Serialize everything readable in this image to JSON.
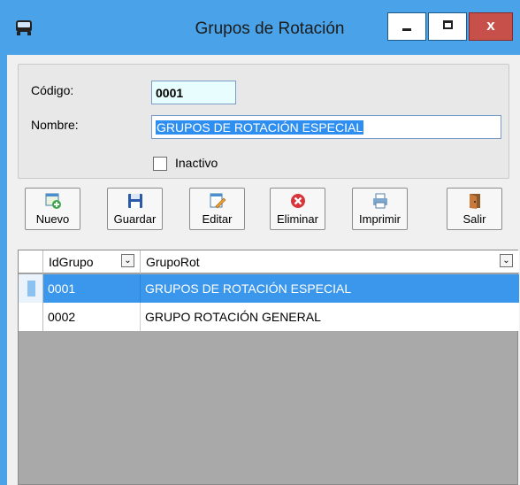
{
  "window": {
    "title": "Grupos de Rotación",
    "min_glyph": "",
    "max_glyph": "",
    "close_glyph": "x"
  },
  "form": {
    "codigo_label": "Código:",
    "codigo_value": "0001",
    "nombre_label": "Nombre:",
    "nombre_value": "GRUPOS DE ROTACIÓN ESPECIAL",
    "inactivo_label": "Inactivo",
    "inactivo_checked": false
  },
  "toolbar": [
    {
      "label": "Nuevo",
      "icon": "new-record-icon"
    },
    {
      "label": "Guardar",
      "icon": "save-icon"
    },
    {
      "label": "Editar",
      "icon": "edit-icon"
    },
    {
      "label": "Eliminar",
      "icon": "delete-icon"
    },
    {
      "label": "Imprimir",
      "icon": "print-icon"
    },
    {
      "label": "Salir",
      "icon": "exit-door-icon"
    }
  ],
  "grid": {
    "columns": [
      "IdGrupo",
      "GrupoRot"
    ],
    "rows": [
      {
        "id": "0001",
        "name": "GRUPOS DE ROTACIÓN ESPECIAL",
        "selected": true
      },
      {
        "id": "0002",
        "name": "GRUPO ROTACIÓN GENERAL",
        "selected": false
      }
    ]
  },
  "colors": {
    "titlebar": "#4aa3e8",
    "selection": "#3a97ec",
    "close": "#c7504a"
  }
}
